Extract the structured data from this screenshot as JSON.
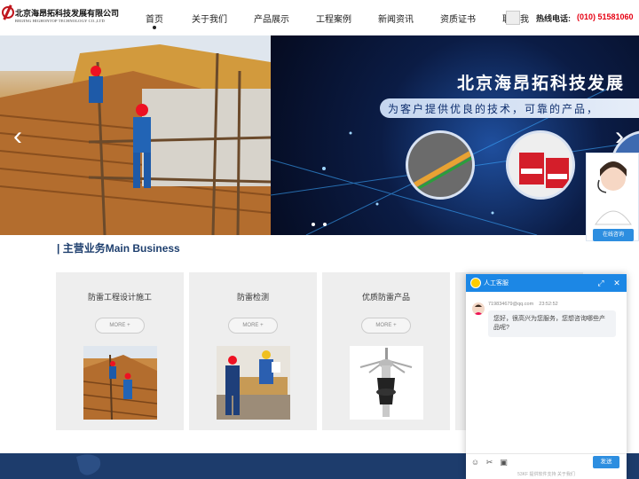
{
  "header": {
    "logo_cn": "北京海昂拓科技发展有限公司",
    "logo_en": "BEIJING HIGHONTOP TECHNOLOGY CO.,LTD",
    "nav": [
      "首页",
      "关于我们",
      "产品展示",
      "工程案例",
      "新闻资讯",
      "资质证书",
      "联系我"
    ],
    "hotline_label": "热线电话:",
    "hotline_number": "(010) 51581060",
    "brand_color": "#c0161d",
    "hotline_color": "#e60012"
  },
  "banner": {
    "title": "北京海昂拓科技发展",
    "slogan": "为客户提供优良的技术，可靠的产品，",
    "prev_icon": "chevron-left-icon",
    "next_icon": "chevron-right-icon"
  },
  "side_service": {
    "button_label": "在线咨询"
  },
  "main_business": {
    "title": "| 主营业务Main Business",
    "cards": [
      {
        "title": "防雷工程设计施工",
        "more": "MORE +"
      },
      {
        "title": "防雷检测",
        "more": "MORE +"
      },
      {
        "title": "优质防雷产品",
        "more": "MORE +"
      }
    ]
  },
  "chat": {
    "title": "人工客服",
    "sender": "719834679@qq.com",
    "time": "23:52:52",
    "message": "您好，很高兴为您服务，您想咨询哪些产品呢?",
    "send_label": "发送",
    "footer": "53KF 提供软件支持   关于我们"
  }
}
